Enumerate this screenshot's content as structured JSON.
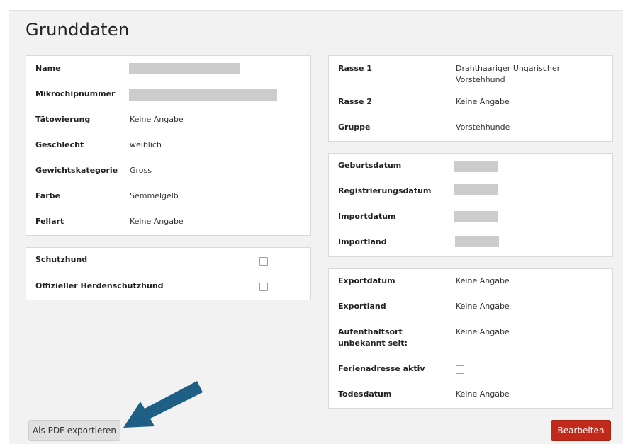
{
  "page": {
    "title": "Grunddaten"
  },
  "basic_card": {
    "rows": [
      {
        "label": "Name",
        "value": ""
      },
      {
        "label": "Mikrochipnummer",
        "value": ""
      },
      {
        "label": "Tätowierung",
        "value": "Keine Angabe"
      },
      {
        "label": "Geschlecht",
        "value": "weiblich"
      },
      {
        "label": "Gewichtskategorie",
        "value": "Gross"
      },
      {
        "label": "Farbe",
        "value": "Semmelgelb"
      },
      {
        "label": "Fellart",
        "value": "Keine Angabe"
      }
    ]
  },
  "flags_card": {
    "rows": [
      {
        "label": "Schutzhund",
        "checked": false
      },
      {
        "label": "Offizieller Herdenschutzhund",
        "checked": false
      }
    ]
  },
  "breed_card": {
    "rows": [
      {
        "label": "Rasse 1",
        "value": "Drahthaariger Ungarischer Vorstehhund"
      },
      {
        "label": "Rasse 2",
        "value": "Keine Angabe"
      },
      {
        "label": "Gruppe",
        "value": "Vorstehhunde"
      }
    ]
  },
  "dates_card": {
    "rows": [
      {
        "label": "Geburtsdatum",
        "value": ""
      },
      {
        "label": "Registrierungsdatum",
        "value": ""
      },
      {
        "label": "Importdatum",
        "value": ""
      },
      {
        "label": "Importland",
        "value": ""
      }
    ]
  },
  "export_card": {
    "rows": [
      {
        "label": "Exportdatum",
        "value": "Keine Angabe"
      },
      {
        "label": "Exportland",
        "value": "Keine Angabe"
      },
      {
        "label": "Aufenthaltsort unbekannt seit:",
        "value": "Keine Angabe"
      },
      {
        "label": "Ferienadresse aktiv",
        "checked": false
      },
      {
        "label": "Todesdatum",
        "value": "Keine Angabe"
      }
    ]
  },
  "actions": {
    "pdf_label": "Als PDF exportieren",
    "edit_label": "Bearbeiten"
  },
  "colors": {
    "primary_button": "#c1291a",
    "arrow": "#1e5f86",
    "redaction": "#cccccc"
  }
}
